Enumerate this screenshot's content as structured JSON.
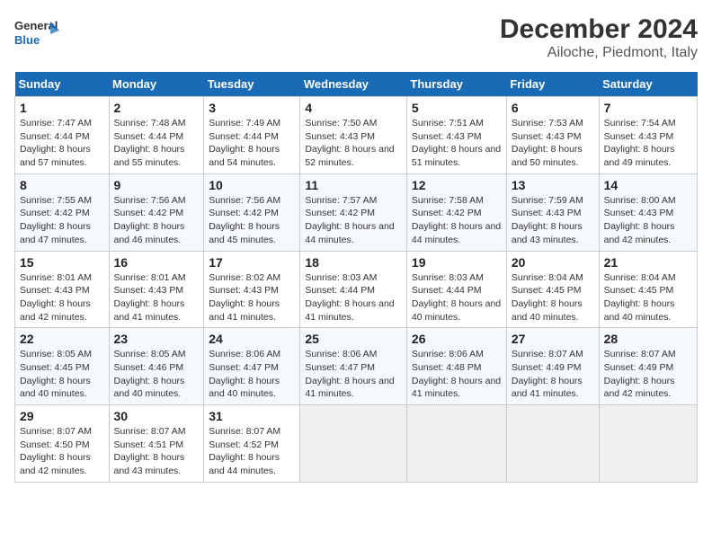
{
  "logo": {
    "text_general": "General",
    "text_blue": "Blue"
  },
  "title": "December 2024",
  "subtitle": "Ailoche, Piedmont, Italy",
  "days_of_week": [
    "Sunday",
    "Monday",
    "Tuesday",
    "Wednesday",
    "Thursday",
    "Friday",
    "Saturday"
  ],
  "weeks": [
    [
      {
        "day": "1",
        "sunrise": "Sunrise: 7:47 AM",
        "sunset": "Sunset: 4:44 PM",
        "daylight": "Daylight: 8 hours and 57 minutes."
      },
      {
        "day": "2",
        "sunrise": "Sunrise: 7:48 AM",
        "sunset": "Sunset: 4:44 PM",
        "daylight": "Daylight: 8 hours and 55 minutes."
      },
      {
        "day": "3",
        "sunrise": "Sunrise: 7:49 AM",
        "sunset": "Sunset: 4:44 PM",
        "daylight": "Daylight: 8 hours and 54 minutes."
      },
      {
        "day": "4",
        "sunrise": "Sunrise: 7:50 AM",
        "sunset": "Sunset: 4:43 PM",
        "daylight": "Daylight: 8 hours and 52 minutes."
      },
      {
        "day": "5",
        "sunrise": "Sunrise: 7:51 AM",
        "sunset": "Sunset: 4:43 PM",
        "daylight": "Daylight: 8 hours and 51 minutes."
      },
      {
        "day": "6",
        "sunrise": "Sunrise: 7:53 AM",
        "sunset": "Sunset: 4:43 PM",
        "daylight": "Daylight: 8 hours and 50 minutes."
      },
      {
        "day": "7",
        "sunrise": "Sunrise: 7:54 AM",
        "sunset": "Sunset: 4:43 PM",
        "daylight": "Daylight: 8 hours and 49 minutes."
      }
    ],
    [
      {
        "day": "8",
        "sunrise": "Sunrise: 7:55 AM",
        "sunset": "Sunset: 4:42 PM",
        "daylight": "Daylight: 8 hours and 47 minutes."
      },
      {
        "day": "9",
        "sunrise": "Sunrise: 7:56 AM",
        "sunset": "Sunset: 4:42 PM",
        "daylight": "Daylight: 8 hours and 46 minutes."
      },
      {
        "day": "10",
        "sunrise": "Sunrise: 7:56 AM",
        "sunset": "Sunset: 4:42 PM",
        "daylight": "Daylight: 8 hours and 45 minutes."
      },
      {
        "day": "11",
        "sunrise": "Sunrise: 7:57 AM",
        "sunset": "Sunset: 4:42 PM",
        "daylight": "Daylight: 8 hours and 44 minutes."
      },
      {
        "day": "12",
        "sunrise": "Sunrise: 7:58 AM",
        "sunset": "Sunset: 4:42 PM",
        "daylight": "Daylight: 8 hours and 44 minutes."
      },
      {
        "day": "13",
        "sunrise": "Sunrise: 7:59 AM",
        "sunset": "Sunset: 4:43 PM",
        "daylight": "Daylight: 8 hours and 43 minutes."
      },
      {
        "day": "14",
        "sunrise": "Sunrise: 8:00 AM",
        "sunset": "Sunset: 4:43 PM",
        "daylight": "Daylight: 8 hours and 42 minutes."
      }
    ],
    [
      {
        "day": "15",
        "sunrise": "Sunrise: 8:01 AM",
        "sunset": "Sunset: 4:43 PM",
        "daylight": "Daylight: 8 hours and 42 minutes."
      },
      {
        "day": "16",
        "sunrise": "Sunrise: 8:01 AM",
        "sunset": "Sunset: 4:43 PM",
        "daylight": "Daylight: 8 hours and 41 minutes."
      },
      {
        "day": "17",
        "sunrise": "Sunrise: 8:02 AM",
        "sunset": "Sunset: 4:43 PM",
        "daylight": "Daylight: 8 hours and 41 minutes."
      },
      {
        "day": "18",
        "sunrise": "Sunrise: 8:03 AM",
        "sunset": "Sunset: 4:44 PM",
        "daylight": "Daylight: 8 hours and 41 minutes."
      },
      {
        "day": "19",
        "sunrise": "Sunrise: 8:03 AM",
        "sunset": "Sunset: 4:44 PM",
        "daylight": "Daylight: 8 hours and 40 minutes."
      },
      {
        "day": "20",
        "sunrise": "Sunrise: 8:04 AM",
        "sunset": "Sunset: 4:45 PM",
        "daylight": "Daylight: 8 hours and 40 minutes."
      },
      {
        "day": "21",
        "sunrise": "Sunrise: 8:04 AM",
        "sunset": "Sunset: 4:45 PM",
        "daylight": "Daylight: 8 hours and 40 minutes."
      }
    ],
    [
      {
        "day": "22",
        "sunrise": "Sunrise: 8:05 AM",
        "sunset": "Sunset: 4:45 PM",
        "daylight": "Daylight: 8 hours and 40 minutes."
      },
      {
        "day": "23",
        "sunrise": "Sunrise: 8:05 AM",
        "sunset": "Sunset: 4:46 PM",
        "daylight": "Daylight: 8 hours and 40 minutes."
      },
      {
        "day": "24",
        "sunrise": "Sunrise: 8:06 AM",
        "sunset": "Sunset: 4:47 PM",
        "daylight": "Daylight: 8 hours and 40 minutes."
      },
      {
        "day": "25",
        "sunrise": "Sunrise: 8:06 AM",
        "sunset": "Sunset: 4:47 PM",
        "daylight": "Daylight: 8 hours and 41 minutes."
      },
      {
        "day": "26",
        "sunrise": "Sunrise: 8:06 AM",
        "sunset": "Sunset: 4:48 PM",
        "daylight": "Daylight: 8 hours and 41 minutes."
      },
      {
        "day": "27",
        "sunrise": "Sunrise: 8:07 AM",
        "sunset": "Sunset: 4:49 PM",
        "daylight": "Daylight: 8 hours and 41 minutes."
      },
      {
        "day": "28",
        "sunrise": "Sunrise: 8:07 AM",
        "sunset": "Sunset: 4:49 PM",
        "daylight": "Daylight: 8 hours and 42 minutes."
      }
    ],
    [
      {
        "day": "29",
        "sunrise": "Sunrise: 8:07 AM",
        "sunset": "Sunset: 4:50 PM",
        "daylight": "Daylight: 8 hours and 42 minutes."
      },
      {
        "day": "30",
        "sunrise": "Sunrise: 8:07 AM",
        "sunset": "Sunset: 4:51 PM",
        "daylight": "Daylight: 8 hours and 43 minutes."
      },
      {
        "day": "31",
        "sunrise": "Sunrise: 8:07 AM",
        "sunset": "Sunset: 4:52 PM",
        "daylight": "Daylight: 8 hours and 44 minutes."
      },
      null,
      null,
      null,
      null
    ]
  ]
}
